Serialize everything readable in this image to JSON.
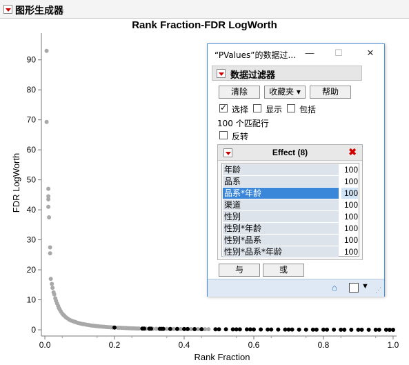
{
  "outline": {
    "title": "图形生成器"
  },
  "chart_data": {
    "type": "scatter",
    "title": "Rank Fraction-FDR LogWorth",
    "xlabel": "Rank Fraction",
    "ylabel": "FDR LogWorth",
    "xlim": [
      -0.01,
      1.01
    ],
    "ylim": [
      0,
      95
    ],
    "xticks": [
      "0.0",
      "0.2",
      "0.4",
      "0.6",
      "0.8",
      "1.0"
    ],
    "yticks": [
      "0",
      "10",
      "20",
      "30",
      "40",
      "50",
      "60",
      "70",
      "80",
      "90"
    ],
    "grid": false,
    "series": [
      {
        "color": "#a8a8a8",
        "points": [
          [
            0.005,
            93
          ],
          [
            0.005,
            69.3
          ],
          [
            0.01,
            47
          ],
          [
            0.01,
            44.5
          ],
          [
            0.01,
            43.5
          ],
          [
            0.01,
            41
          ],
          [
            0.012,
            37.5
          ],
          [
            0.015,
            27.5
          ],
          [
            0.015,
            25.5
          ],
          [
            0.017,
            17
          ],
          [
            0.02,
            15.3
          ],
          [
            0.022,
            14
          ],
          [
            0.025,
            12.5
          ],
          [
            0.027,
            11.8
          ],
          [
            0.03,
            10.5
          ],
          [
            0.032,
            9.7
          ],
          [
            0.035,
            8.8
          ],
          [
            0.038,
            8
          ],
          [
            0.04,
            7.3
          ],
          [
            0.043,
            6.7
          ],
          [
            0.046,
            6.1
          ],
          [
            0.05,
            5.4
          ],
          [
            0.053,
            5
          ],
          [
            0.056,
            4.7
          ],
          [
            0.06,
            4.2
          ],
          [
            0.065,
            3.8
          ],
          [
            0.07,
            3.4
          ],
          [
            0.075,
            3.1
          ],
          [
            0.08,
            2.9
          ],
          [
            0.085,
            2.7
          ],
          [
            0.09,
            2.5
          ],
          [
            0.095,
            2.3
          ],
          [
            0.1,
            2.15
          ],
          [
            0.105,
            2.0
          ],
          [
            0.11,
            1.9
          ],
          [
            0.115,
            1.8
          ],
          [
            0.12,
            1.7
          ],
          [
            0.125,
            1.6
          ],
          [
            0.13,
            1.5
          ],
          [
            0.135,
            1.42
          ],
          [
            0.14,
            1.35
          ],
          [
            0.145,
            1.28
          ],
          [
            0.15,
            1.2
          ],
          [
            0.155,
            1.15
          ],
          [
            0.16,
            1.1
          ],
          [
            0.165,
            1.05
          ],
          [
            0.17,
            1.0
          ],
          [
            0.175,
            0.95
          ],
          [
            0.18,
            0.9
          ],
          [
            0.185,
            0.85
          ],
          [
            0.19,
            0.82
          ],
          [
            0.195,
            0.78
          ],
          [
            0.21,
            0.7
          ],
          [
            0.215,
            0.68
          ],
          [
            0.22,
            0.65
          ],
          [
            0.225,
            0.62
          ],
          [
            0.23,
            0.6
          ],
          [
            0.235,
            0.58
          ],
          [
            0.24,
            0.55
          ],
          [
            0.245,
            0.53
          ],
          [
            0.25,
            0.5
          ],
          [
            0.255,
            0.48
          ],
          [
            0.26,
            0.46
          ],
          [
            0.265,
            0.44
          ],
          [
            0.27,
            0.42
          ],
          [
            0.29,
            0.38
          ],
          [
            0.3,
            0.36
          ],
          [
            0.31,
            0.35
          ],
          [
            0.32,
            0.34
          ],
          [
            0.33,
            0.33
          ],
          [
            0.34,
            0.32
          ],
          [
            0.35,
            0.31
          ],
          [
            0.36,
            0.3
          ],
          [
            0.37,
            0.29
          ],
          [
            0.38,
            0.28
          ],
          [
            0.39,
            0.27
          ],
          [
            0.4,
            0.26
          ],
          [
            0.41,
            0.25
          ],
          [
            0.42,
            0.24
          ],
          [
            0.43,
            0.23
          ],
          [
            0.44,
            0.22
          ],
          [
            0.45,
            0.21
          ],
          [
            0.46,
            0.2
          ],
          [
            0.47,
            0.19
          ]
        ]
      },
      {
        "color": "#000000",
        "points": [
          [
            0.2,
            0.75
          ],
          [
            0.28,
            0.4
          ],
          [
            0.285,
            0.39
          ],
          [
            0.3,
            0.37
          ],
          [
            0.305,
            0.36
          ],
          [
            0.33,
            0.33
          ],
          [
            0.335,
            0.33
          ],
          [
            0.34,
            0.32
          ],
          [
            0.36,
            0.3
          ],
          [
            0.38,
            0.28
          ],
          [
            0.4,
            0.26
          ],
          [
            0.41,
            0.25
          ],
          [
            0.43,
            0.23
          ],
          [
            0.45,
            0.21
          ],
          [
            0.49,
            0.18
          ],
          [
            0.5,
            0.17
          ],
          [
            0.52,
            0.16
          ],
          [
            0.54,
            0.15
          ],
          [
            0.55,
            0.15
          ],
          [
            0.56,
            0.14
          ],
          [
            0.58,
            0.13
          ],
          [
            0.59,
            0.13
          ],
          [
            0.6,
            0.12
          ],
          [
            0.62,
            0.11
          ],
          [
            0.64,
            0.1
          ],
          [
            0.65,
            0.1
          ],
          [
            0.67,
            0.09
          ],
          [
            0.69,
            0.09
          ],
          [
            0.7,
            0.08
          ],
          [
            0.71,
            0.08
          ],
          [
            0.73,
            0.07
          ],
          [
            0.75,
            0.07
          ],
          [
            0.77,
            0.06
          ],
          [
            0.78,
            0.06
          ],
          [
            0.8,
            0.05
          ],
          [
            0.81,
            0.05
          ],
          [
            0.83,
            0.05
          ],
          [
            0.85,
            0.04
          ],
          [
            0.86,
            0.04
          ],
          [
            0.88,
            0.04
          ],
          [
            0.9,
            0.03
          ],
          [
            0.91,
            0.03
          ],
          [
            0.93,
            0.03
          ],
          [
            0.95,
            0.02
          ],
          [
            0.96,
            0.02
          ],
          [
            0.98,
            0.02
          ],
          [
            0.99,
            0.01
          ],
          [
            1.0,
            0.01
          ]
        ]
      }
    ]
  },
  "popup": {
    "title": "“PValues”的数据过...",
    "filter_title": "数据过滤器",
    "buttons": {
      "clear": "清除",
      "favorites": "收藏夹 ▾",
      "help": "帮助"
    },
    "options": [
      {
        "label": "选择",
        "checked": true
      },
      {
        "label": "显示",
        "checked": false
      },
      {
        "label": "包括",
        "checked": false
      }
    ],
    "match_text": "100 个匹配行",
    "invert_label": "反转",
    "effect": {
      "title": "Effect (8)",
      "rows": [
        {
          "name": "年龄",
          "count": "100",
          "selected": false
        },
        {
          "name": "品系",
          "count": "100",
          "selected": false
        },
        {
          "name": "品系*年龄",
          "count": "100",
          "selected": true
        },
        {
          "name": "渠道",
          "count": "100",
          "selected": false
        },
        {
          "name": "性别",
          "count": "100",
          "selected": false
        },
        {
          "name": "性别*年龄",
          "count": "100",
          "selected": false
        },
        {
          "name": "性别*品系",
          "count": "100",
          "selected": false
        },
        {
          "name": "性别*品系*年龄",
          "count": "100",
          "selected": false
        }
      ]
    },
    "logic_buttons": {
      "and": "与",
      "or": "或"
    }
  }
}
